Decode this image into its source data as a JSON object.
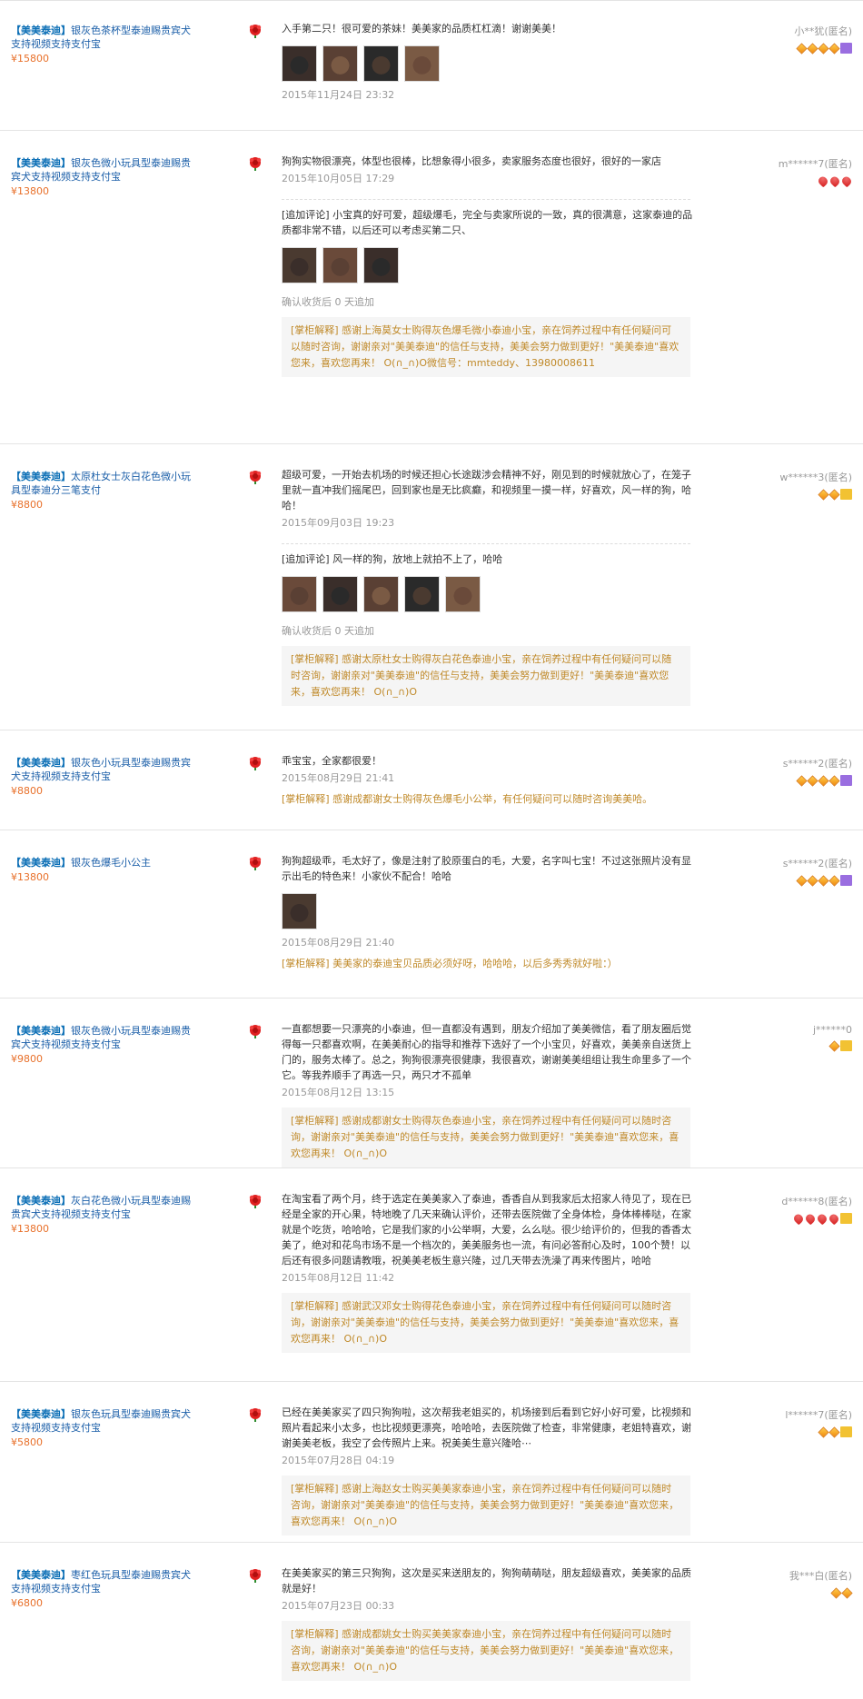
{
  "reviews": [
    {
      "product": {
        "shop": "【美美泰迪】",
        "title": "银灰色茶杯型泰迪赐贵宾犬支持视频支持支付宝",
        "price": "¥15800"
      },
      "text": "入手第二只！很可爱的茶妹！美美家的品质杠杠滴！谢谢美美！",
      "photos": [
        "puppy-photo",
        "puppy-photo",
        "puppy-photo",
        "puppy-photo"
      ],
      "date": "2015年11月24日 23:32",
      "user": {
        "name": "小**犹(匿名)",
        "badges": [
          "diamond",
          "diamond",
          "diamond",
          "diamond",
          "vip"
        ]
      }
    },
    {
      "product": {
        "shop": "【美美泰迪】",
        "title": "银灰色微小玩具型泰迪赐贵宾犬支持视频支持支付宝",
        "price": "¥13800"
      },
      "text": "狗狗实物很漂亮，体型也很棒，比想象得小很多，卖家服务态度也很好，很好的一家店",
      "date": "2015年10月05日 17:29",
      "followup": "[追加评论] 小宝真的好可爱，超级爆毛，完全与卖家所说的一致，真的很满意，这家泰迪的品质都非常不错，以后还可以考虑买第二只、",
      "followup_photos": [
        "puppy-photo",
        "puppy-photo",
        "puppy-photo"
      ],
      "confirm": "确认收货后 0 天追加",
      "reply": "[掌柜解释] 感谢上海莫女士购得灰色爆毛微小泰迪小宝，亲在饲养过程中有任何疑问可以随时咨询，谢谢亲对\"美美泰迪\"的信任与支持，美美会努力做到更好！\"美美泰迪\"喜欢您来，喜欢您再来！ O(∩_∩)O微信号：mmteddy、13980008611",
      "user": {
        "name": "m******7(匿名)",
        "badges": [
          "heart",
          "heart",
          "heart"
        ]
      }
    },
    {
      "product": {
        "shop": "【美美泰迪】",
        "title": "太原杜女士灰白花色微小玩具型泰迪分三笔支付",
        "price": "¥8800"
      },
      "text": "超级可爱，一开始去机场的时候还担心长途跋涉会精神不好，刚见到的时候就放心了，在笼子里就一直冲我们摇尾巴，回到家也是无比疯癫，和视频里一摸一样，好喜欢，风一样的狗，哈哈！",
      "date": "2015年09月03日 19:23",
      "followup": "[追加评论] 风一样的狗，放地上就拍不上了，哈哈",
      "followup_photos": [
        "puppy-photo",
        "puppy-photo",
        "puppy-photo",
        "puppy-photo",
        "puppy-photo"
      ],
      "confirm": "确认收货后 0 天追加",
      "reply": "[掌柜解释] 感谢太原杜女士购得灰白花色泰迪小宝，亲在饲养过程中有任何疑问可以随时咨询，谢谢亲对\"美美泰迪\"的信任与支持，美美会努力做到更好！\"美美泰迪\"喜欢您来，喜欢您再来！ O(∩_∩)O",
      "user": {
        "name": "w******3(匿名)",
        "badges": [
          "diamond",
          "diamond",
          "vip-y"
        ]
      }
    },
    {
      "product": {
        "shop": "【美美泰迪】",
        "title": "银灰色小玩具型泰迪赐贵宾犬支持视频支持支付宝",
        "price": "¥8800"
      },
      "text": "乖宝宝，全家都很爱！",
      "date": "2015年08月29日 21:41",
      "reply_inline": "[掌柜解释] 感谢成都谢女士购得灰色爆毛小公举，有任何疑问可以随时咨询美美哈。",
      "user": {
        "name": "s******2(匿名)",
        "badges": [
          "diamond",
          "diamond",
          "diamond",
          "diamond",
          "vip"
        ]
      }
    },
    {
      "product": {
        "shop": "【美美泰迪】",
        "title": "银灰色爆毛小公主",
        "price": "¥13800"
      },
      "text": "狗狗超级乖，毛太好了，像是注射了胶原蛋白的毛，大爱，名字叫七宝！不过这张照片没有显示出毛的特色来！小家伙不配合！哈哈",
      "photos": [
        "owner-photo"
      ],
      "date": "2015年08月29日 21:40",
      "reply_inline": "[掌柜解释] 美美家的泰迪宝贝品质必须好呀，哈哈哈，以后多秀秀就好啦：）",
      "user": {
        "name": "s******2(匿名)",
        "badges": [
          "diamond",
          "diamond",
          "diamond",
          "diamond",
          "vip"
        ]
      }
    },
    {
      "product": {
        "shop": "【美美泰迪】",
        "title": "银灰色微小玩具型泰迪赐贵宾犬支持视频支持支付宝",
        "price": "¥9800"
      },
      "text": "一直都想要一只漂亮的小泰迪，但一直都没有遇到，朋友介绍加了美美微信，看了朋友圈后觉得每一只都喜欢啊，在美美耐心的指导和推荐下选好了一个小宝贝，好喜欢，美美亲自送货上门的，服务太棒了。总之，狗狗很漂亮很健康，我很喜欢，谢谢美美组组让我生命里多了一个它。等我养顺手了再选一只，两只才不孤单",
      "date": "2015年08月12日 13:15",
      "reply": "[掌柜解释] 感谢成都谢女士购得灰色泰迪小宝，亲在饲养过程中有任何疑问可以随时咨询，谢谢亲对\"美美泰迪\"的信任与支持，美美会努力做到更好！\"美美泰迪\"喜欢您来，喜欢您再来！ O(∩_∩)O",
      "user": {
        "name": "j******0",
        "badges": [
          "diamond",
          "vip-y"
        ]
      }
    },
    {
      "product": {
        "shop": "【美美泰迪】",
        "title": "灰白花色微小玩具型泰迪赐贵宾犬支持视频支持支付宝",
        "price": "¥13800"
      },
      "text": "在淘宝看了两个月，终于选定在美美家入了泰迪，香香自从到我家后太招家人待见了，现在已经是全家的开心果，特地晚了几天来确认评价，还带去医院做了全身体检，身体棒棒哒，在家就是个吃货，哈哈哈，它是我们家的小公举啊，大爱，么么哒。很少给评价的，但我的香香太美了，绝对和花鸟市场不是一个档次的，美美服务也一流，有问必答耐心及时，100个赞！以后还有很多问题请教哦，祝美美老板生意兴隆，过几天带去洗澡了再来传图片，哈哈",
      "date": "2015年08月12日 11:42",
      "reply": "[掌柜解释] 感谢武汉邓女士购得花色泰迪小宝，亲在饲养过程中有任何疑问可以随时咨询，谢谢亲对\"美美泰迪\"的信任与支持，美美会努力做到更好！\"美美泰迪\"喜欢您来，喜欢您再来！ O(∩_∩)O",
      "user": {
        "name": "d******8(匿名)",
        "badges": [
          "heart",
          "heart",
          "heart",
          "heart",
          "vip-y"
        ]
      }
    },
    {
      "product": {
        "shop": "【美美泰迪】",
        "title": "银灰色玩具型泰迪赐贵宾犬支持视频支持支付宝",
        "price": "¥5800"
      },
      "text": "已经在美美家买了四只狗狗啦，这次帮我老姐买的，机场接到后看到它好小好可爱，比视频和照片看起来小太多，也比视频更漂亮，哈哈哈，去医院做了检查，非常健康，老姐特喜欢，谢谢美美老板，我空了会传照片上来。祝美美生意兴隆哈⋯",
      "date": "2015年07月28日 04:19",
      "reply": "[掌柜解释] 感谢上海赵女士购买美美家泰迪小宝，亲在饲养过程中有任何疑问可以随时咨询，谢谢亲对\"美美泰迪\"的信任与支持，美美会努力做到更好！\"美美泰迪\"喜欢您来，喜欢您再来！ O(∩_∩)O",
      "user": {
        "name": "l******7(匿名)",
        "badges": [
          "diamond",
          "diamond",
          "vip-y"
        ]
      }
    },
    {
      "product": {
        "shop": "【美美泰迪】",
        "title": "枣红色玩具型泰迪赐贵宾犬支持视频支持支付宝",
        "price": "¥6800"
      },
      "text": "在美美家买的第三只狗狗，这次是买来送朋友的，狗狗萌萌哒，朋友超级喜欢，美美家的品质就是好！",
      "date": "2015年07月23日 00:33",
      "reply": "[掌柜解释] 感谢成都姚女士购买美美家泰迪小宝，亲在饲养过程中有任何疑问可以随时咨询，谢谢亲对\"美美泰迪\"的信任与支持，美美会努力做到更好！\"美美泰迪\"喜欢您来，喜欢您再来！ O(∩_∩)O",
      "user": {
        "name": "我***白(匿名)",
        "badges": [
          "diamond",
          "diamond"
        ]
      }
    }
  ]
}
